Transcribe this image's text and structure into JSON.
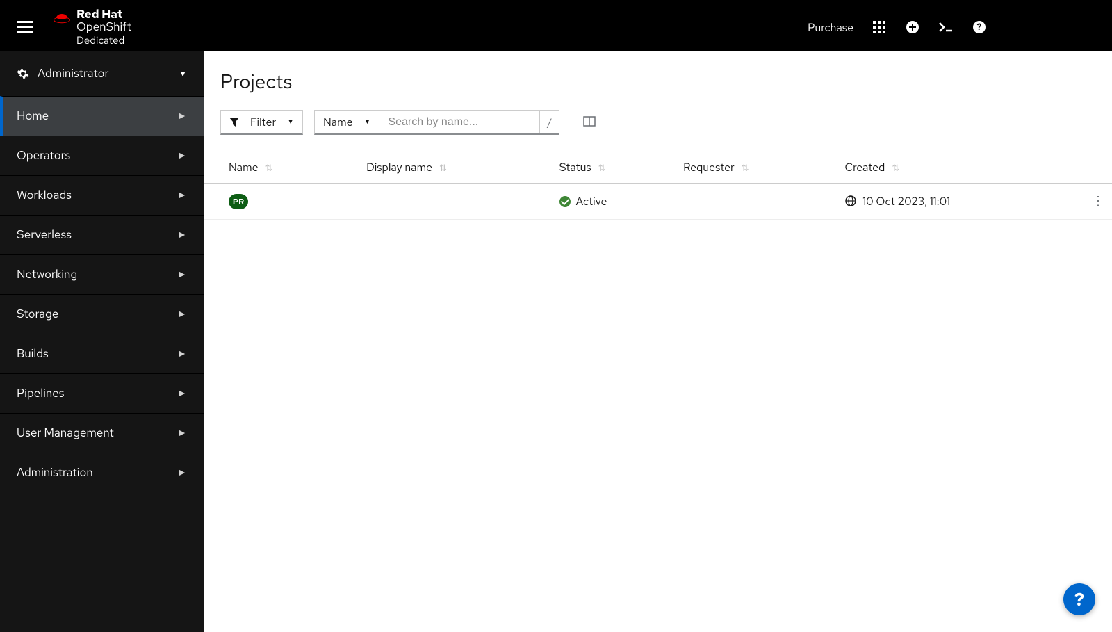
{
  "brand": {
    "line1": "Red Hat",
    "line2": "OpenShift",
    "line3": "Dedicated"
  },
  "masthead": {
    "purchase": "Purchase"
  },
  "perspective": {
    "label": "Administrator"
  },
  "sidebar": {
    "items": [
      {
        "label": "Home",
        "active": true
      },
      {
        "label": "Operators",
        "active": false
      },
      {
        "label": "Workloads",
        "active": false
      },
      {
        "label": "Serverless",
        "active": false
      },
      {
        "label": "Networking",
        "active": false
      },
      {
        "label": "Storage",
        "active": false
      },
      {
        "label": "Builds",
        "active": false
      },
      {
        "label": "Pipelines",
        "active": false
      },
      {
        "label": "User Management",
        "active": false
      },
      {
        "label": "Administration",
        "active": false
      }
    ]
  },
  "page": {
    "title": "Projects"
  },
  "toolbar": {
    "filter_label": "Filter",
    "name_label": "Name",
    "search_placeholder": "Search by name...",
    "slash": "/"
  },
  "table": {
    "columns": {
      "name": "Name",
      "display_name": "Display name",
      "status": "Status",
      "requester": "Requester",
      "created": "Created"
    },
    "rows": [
      {
        "badge": "PR",
        "name": "",
        "display_name": "",
        "status": "Active",
        "requester": "",
        "created": "10 Oct 2023, 11:01"
      }
    ]
  },
  "fab": {
    "label": "?"
  }
}
